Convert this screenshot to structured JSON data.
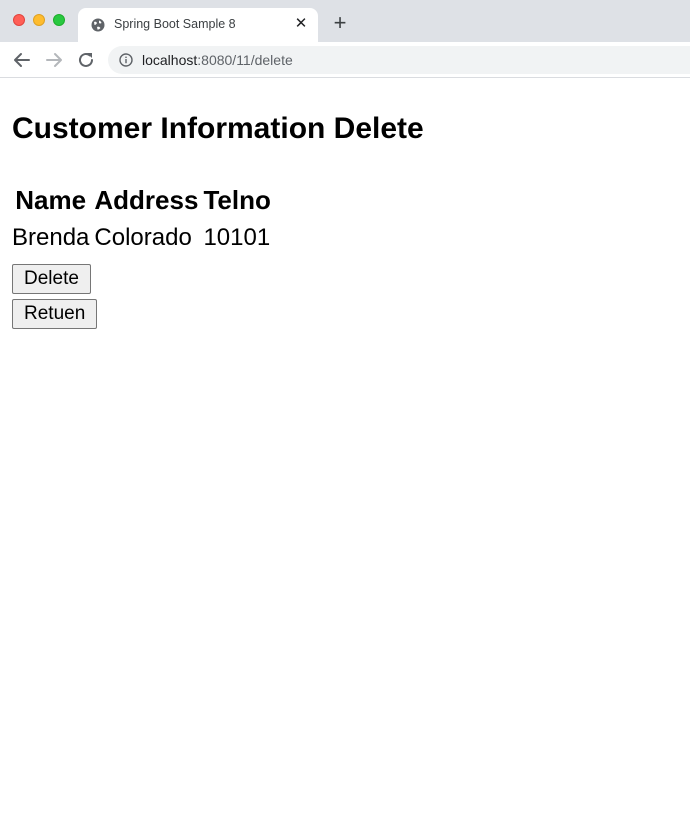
{
  "browser": {
    "tab_title": "Spring Boot Sample 8",
    "tab_close": "✕",
    "new_tab": "+",
    "url_host": "localhost",
    "url_path": ":8080/11/delete"
  },
  "page": {
    "heading": "Customer Information Delete",
    "table": {
      "headers": [
        "Name",
        "Address",
        "Telno"
      ],
      "rows": [
        [
          "Brenda",
          "Colorado",
          "10101"
        ]
      ]
    },
    "delete_label": "Delete",
    "return_label": "Retuen"
  },
  "icons": {
    "favicon": "globe-icon",
    "back": "arrow-left-icon",
    "forward": "arrow-right-icon",
    "reload": "reload-icon",
    "info": "info-icon"
  }
}
